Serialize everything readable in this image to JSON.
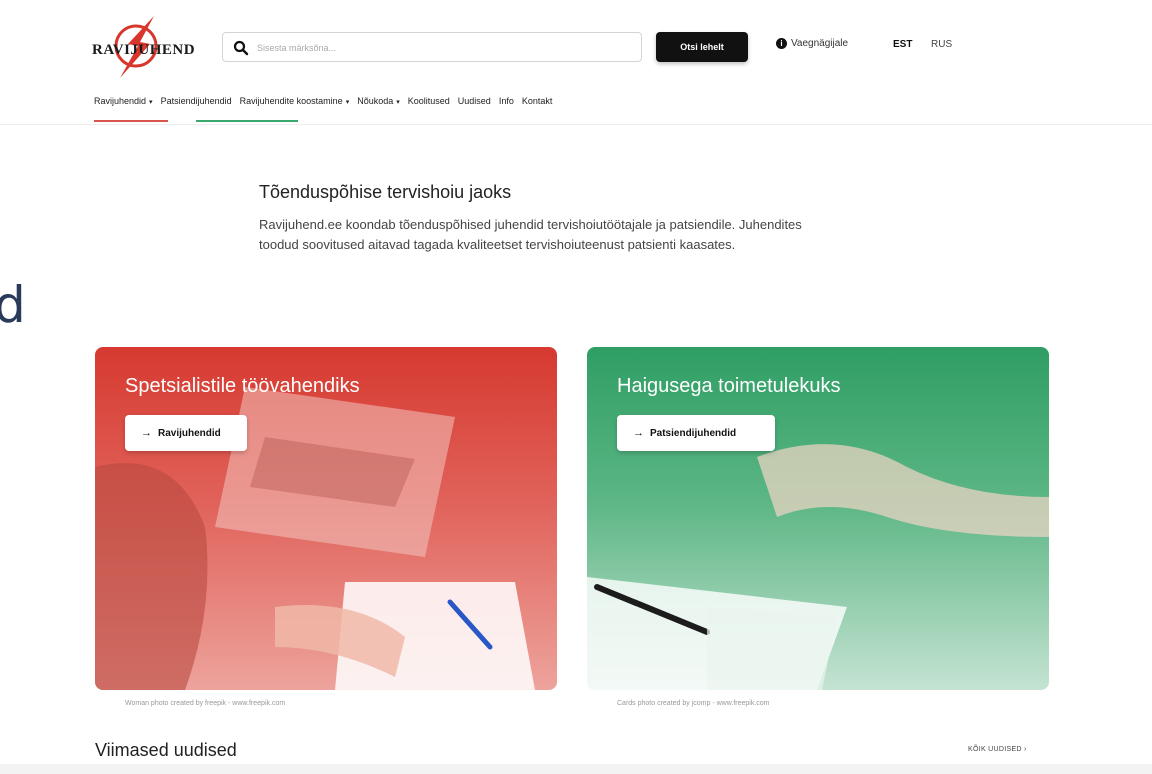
{
  "header": {
    "logo_text": "RAVIJUHEND",
    "search": {
      "placeholder": "Sisesta märksõna..."
    },
    "search_button": "Otsi lehelt",
    "help_link": "Vaegnägijale",
    "languages": [
      "EST",
      "RUS"
    ],
    "active_language": "EST"
  },
  "nav": {
    "items": [
      {
        "label": "Ravijuhendid",
        "dropdown": true
      },
      {
        "label": "Patsiendijuhendid",
        "dropdown": false
      },
      {
        "label": "Ravijuhendite koostamine",
        "dropdown": true
      },
      {
        "label": "Nõukoda",
        "dropdown": true
      },
      {
        "label": "Koolitused",
        "dropdown": false
      },
      {
        "label": "Uudised",
        "dropdown": false
      },
      {
        "label": "Info",
        "dropdown": false
      },
      {
        "label": "Kontakt",
        "dropdown": false
      }
    ],
    "caret": "▾"
  },
  "left_edge_text": "d",
  "intro": {
    "title": "Tõenduspõhise tervishoiu jaoks",
    "text": "Ravijuhend.ee koondab tõenduspõhised juhendid tervishoiutöötajale ja patsiendile. Juhendites toodud soovitused aitavad tagada kvaliteetset tervishoiuteenust patsienti kaasates."
  },
  "cards": [
    {
      "title": "Spetsialistile töövahendiks",
      "button": "Ravijuhendid",
      "credit": "Woman photo created by freepik - www.freepik.com",
      "color": "#d6392f"
    },
    {
      "title": "Haigusega toimetulekuks",
      "button": "Patsiendijuhendid",
      "credit": "Cards photo created by jcomp - www.freepik.com",
      "color": "#2f9e64"
    }
  ],
  "arrow": "→",
  "news": {
    "title": "Viimased uudised",
    "all_link": "KÕIK UUDISED ›"
  }
}
